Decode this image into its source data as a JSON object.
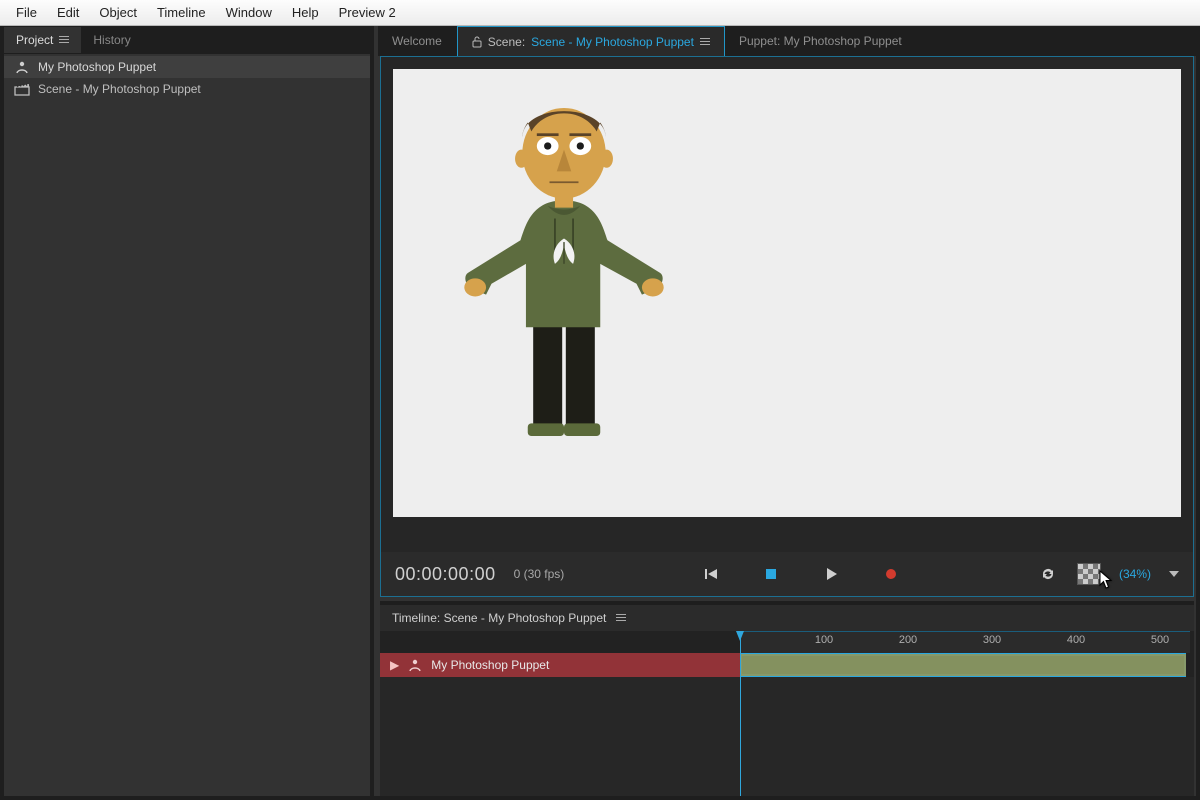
{
  "menu": {
    "items": [
      "File",
      "Edit",
      "Object",
      "Timeline",
      "Window",
      "Help",
      "Preview 2"
    ]
  },
  "left": {
    "tabs": {
      "project": "Project",
      "history": "History"
    },
    "items": [
      {
        "label": "My Photoshop Puppet",
        "icon": "puppet",
        "selected": true
      },
      {
        "label": "Scene - My Photoshop Puppet",
        "icon": "scene",
        "selected": false
      }
    ]
  },
  "tabs": {
    "welcome": "Welcome",
    "scene_prefix": "Scene:",
    "scene_link": "Scene - My Photoshop Puppet",
    "puppet": "Puppet: My Photoshop Puppet"
  },
  "playbar": {
    "timecode": "00:00:00:00",
    "fps": "0 (30 fps)",
    "zoom": "(34%)"
  },
  "timeline": {
    "title": "Timeline: Scene - My Photoshop Puppet",
    "ticks": [
      "100",
      "200",
      "300",
      "400",
      "500"
    ],
    "track": "My Photoshop Puppet"
  }
}
